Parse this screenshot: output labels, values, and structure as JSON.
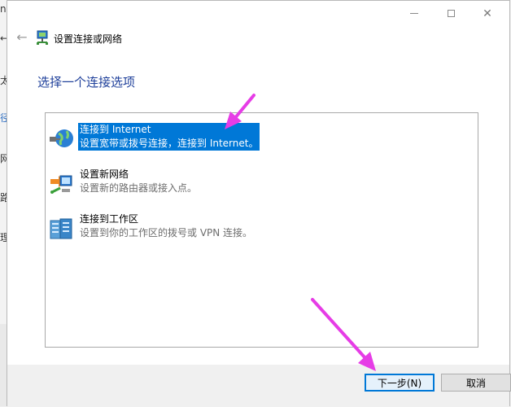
{
  "background_window": {
    "glyphs": [
      "nt",
      "←",
      "太",
      "径",
      "网",
      "路",
      "理"
    ]
  },
  "window": {
    "title": "设置连接或网络",
    "controls": {
      "close": "✕"
    }
  },
  "header": {
    "back_icon": "back-arrow-icon",
    "back_glyph": "←"
  },
  "instruction": "选择一个连接选项",
  "options": [
    {
      "label": "连接到 Internet",
      "description": "设置宽带或拨号连接，连接到 Internet。",
      "icon": "globe-icon",
      "selected": true
    },
    {
      "label": "设置新网络",
      "description": "设置新的路由器或接入点。",
      "icon": "router-icon",
      "selected": false
    },
    {
      "label": "连接到工作区",
      "description": "设置到你的工作区的拨号或 VPN 连接。",
      "icon": "workplace-icon",
      "selected": false
    }
  ],
  "buttons": {
    "next": "下一步(N)",
    "cancel": "取消"
  },
  "colors": {
    "selection": "#0078d7",
    "instruction": "#1e3f9a",
    "annotation_arrow": "#e63ce6"
  }
}
